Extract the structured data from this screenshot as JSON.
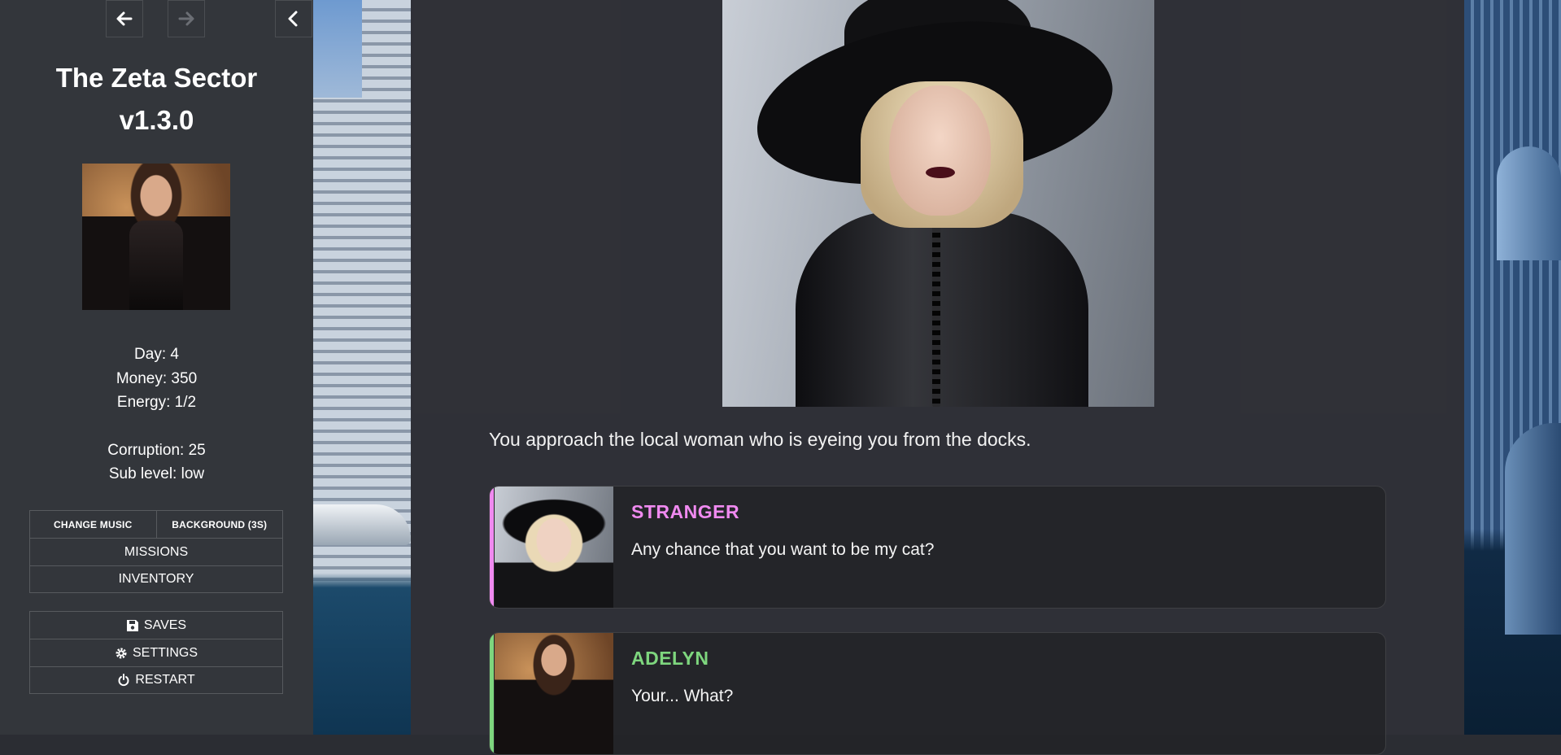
{
  "game": {
    "title": "The Zeta Sector",
    "version": "v1.3.0"
  },
  "nav": {
    "back_icon": "arrow-left-icon",
    "forward_icon": "arrow-right-icon",
    "collapse_icon": "chevron-left-icon"
  },
  "stats": {
    "day": "Day: 4",
    "money": "Money: 350",
    "energy": "Energy: 1/2",
    "corruption": "Corruption: 25",
    "sub_level": "Sub level: low"
  },
  "menu": {
    "change_music": "CHANGE MUSIC",
    "background": "BACKGROUND (3S)",
    "missions": "MISSIONS",
    "inventory": "INVENTORY",
    "saves": "SAVES",
    "settings": "SETTINGS",
    "restart": "RESTART"
  },
  "story": {
    "intro": "You approach the local woman who is eyeing you from the docks.",
    "dialogs": [
      {
        "name": "STRANGER",
        "text": "Any chance that you want to be my cat?",
        "color": "#f08af0"
      },
      {
        "name": "ADELYN",
        "text": "Your... What?",
        "color": "#7ed67e"
      }
    ]
  }
}
